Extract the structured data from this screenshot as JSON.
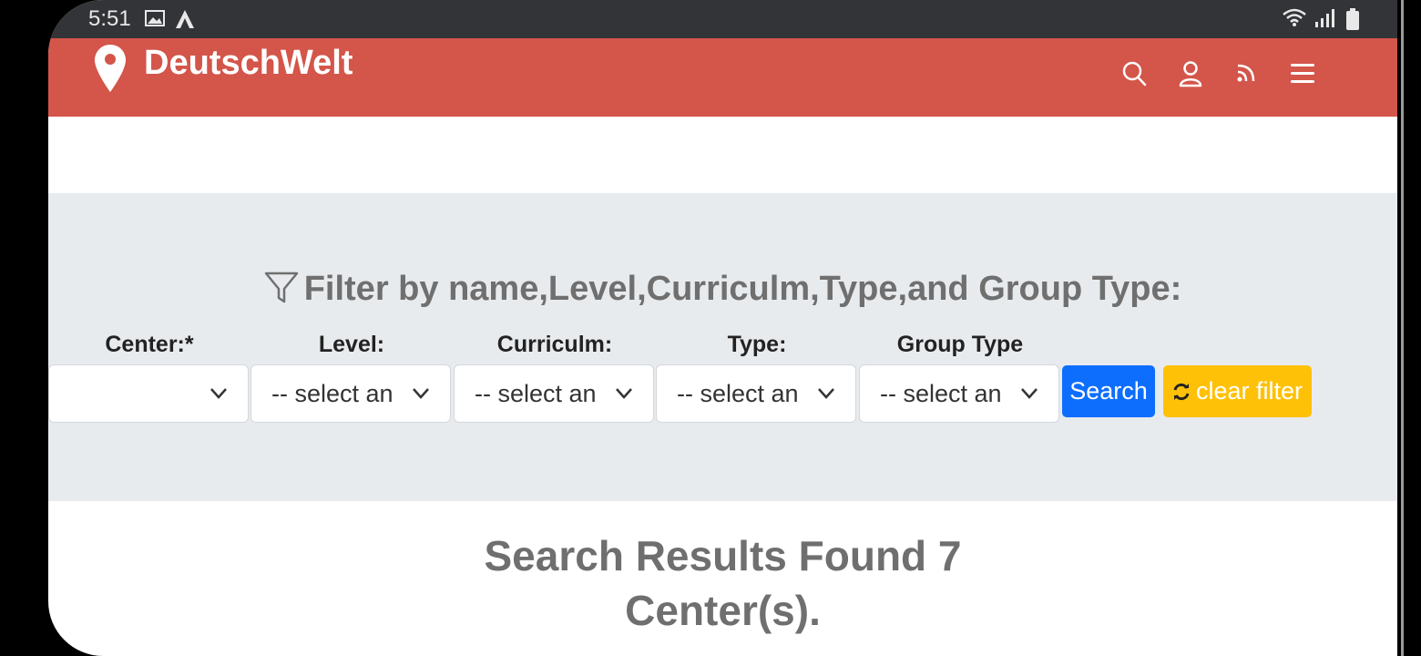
{
  "status_bar": {
    "time": "5:51",
    "icons": [
      "image-icon",
      "a-icon",
      "wifi-icon",
      "signal-icon",
      "battery-icon"
    ]
  },
  "app_bar": {
    "brand": "DeutschWelt",
    "brand_color": "#d4554a",
    "icons": [
      "search-icon",
      "user-icon",
      "rss-icon",
      "menu-icon"
    ]
  },
  "filter": {
    "title": "Filter by name,Level,Curriculm,Type,and Group Type:",
    "fields": [
      {
        "label": "Center:*",
        "value": ""
      },
      {
        "label": "Level:",
        "value": "-- select an"
      },
      {
        "label": "Curriculm:",
        "value": "-- select an"
      },
      {
        "label": "Type:",
        "value": "-- select an"
      },
      {
        "label": "Group Type",
        "value": "-- select an"
      }
    ],
    "search_label": "Search",
    "clear_label": "clear filter",
    "search_color": "#0d6efd",
    "clear_color": "#ffc107"
  },
  "results": {
    "line1": "Search Results Found 7",
    "line2": "Center(s)."
  }
}
